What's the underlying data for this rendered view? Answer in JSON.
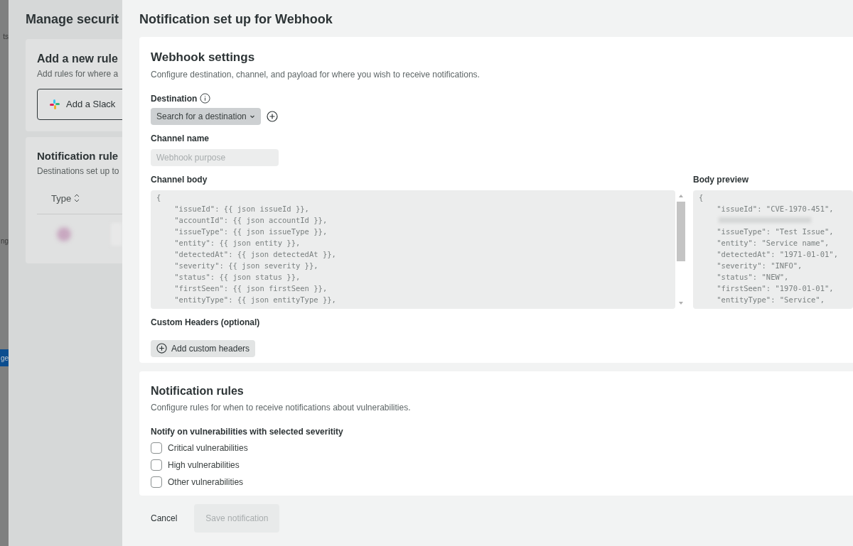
{
  "app_edge": {
    "texts": [
      "ts",
      "ng"
    ],
    "button": "ge"
  },
  "background_page": {
    "title": "Manage securit",
    "add_rule_card": {
      "title": "Add a new rule",
      "description": "Add rules for where a",
      "button": "Add a Slack"
    },
    "rules_card": {
      "title": "Notification rule",
      "description": "Destinations set up to",
      "columns": [
        "Type"
      ]
    }
  },
  "drawer": {
    "title": "Notification set up for Webhook",
    "webhook_settings": {
      "title": "Webhook settings",
      "description": "Configure destination, channel, and payload for where you wish to receive notifications.",
      "destination": {
        "label": "Destination",
        "dropdown": "Search for a destination"
      },
      "channel_name": {
        "label": "Channel name",
        "placeholder": "Webhook purpose"
      },
      "channel_body": {
        "label": "Channel body",
        "lines": [
          "{",
          "    \"issueId\": {{ json issueId }},",
          "    \"accountId\": {{ json accountId }},",
          "    \"issueType\": {{ json issueType }},",
          "    \"entity\": {{ json entity }},",
          "    \"detectedAt\": {{ json detectedAt }},",
          "    \"severity\": {{ json severity }},",
          "    \"status\": {{ json status }},",
          "    \"firstSeen\": {{ json firstSeen }},",
          "    \"entityType\": {{ json entityType }},"
        ]
      },
      "body_preview": {
        "label": "Body preview",
        "lines": [
          {
            "kind": "text",
            "text": "{"
          },
          {
            "kind": "text",
            "text": "    \"issueId\": \"CVE-1970-451\","
          },
          {
            "kind": "redacted"
          },
          {
            "kind": "text",
            "text": "    \"issueType\": \"Test Issue\","
          },
          {
            "kind": "text",
            "text": "    \"entity\": \"Service name\","
          },
          {
            "kind": "text",
            "text": "    \"detectedAt\": \"1971-01-01\","
          },
          {
            "kind": "text",
            "text": "    \"severity\": \"INFO\","
          },
          {
            "kind": "text",
            "text": "    \"status\": \"NEW\","
          },
          {
            "kind": "text",
            "text": "    \"firstSeen\": \"1970-01-01\","
          },
          {
            "kind": "text",
            "text": "    \"entityType\": \"Service\","
          }
        ]
      },
      "custom_headers": {
        "label": "Custom Headers (optional)",
        "button": "Add custom headers"
      }
    },
    "notification_rules": {
      "title": "Notification rules",
      "description": "Configure rules for when to receive notifications about vulnerabilities.",
      "group_label": "Notify on vulnerabilities with selected severitity",
      "options": [
        {
          "label": "Critical vulnerabilities",
          "checked": false
        },
        {
          "label": "High vulnerabilities",
          "checked": false
        },
        {
          "label": "Other vulnerabilities",
          "checked": false
        }
      ]
    },
    "footer": {
      "cancel": "Cancel",
      "save": {
        "label": "Save notification",
        "disabled": true
      }
    }
  }
}
